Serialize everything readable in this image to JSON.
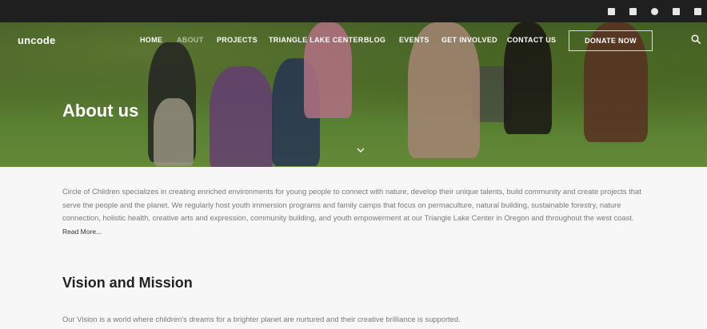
{
  "social": {
    "icons": [
      "facebook-icon",
      "twitter-icon",
      "instagram-icon",
      "email-icon",
      "vimeo-icon"
    ]
  },
  "header": {
    "logo": "uncode",
    "nav": [
      {
        "label": "HOME"
      },
      {
        "label": "ABOUT",
        "active": true
      },
      {
        "label": "PROJECTS"
      },
      {
        "label": "TRIANGLE LAKE CENTER"
      },
      {
        "label": "BLOG"
      },
      {
        "label": "EVENTS"
      },
      {
        "label": "GET INVOLVED"
      },
      {
        "label": "CONTACT US"
      }
    ],
    "donate_label": "DONATE NOW"
  },
  "hero": {
    "title": "About us"
  },
  "main": {
    "intro": "Circle of Children specializes in creating enriched environments for young people to connect with nature, develop their unique talents, build community and create projects that serve the people and the planet. We regularly host youth immersion programs and family camps that focus on permaculture, natural building, sustainable forestry, nature connection, holistic health, creative arts and expression, community building, and youth empowerment at our Triangle Lake Center in Oregon and throughout the west coast.",
    "read_more": "Read More...",
    "section_title": "Vision and Mission",
    "vision": "Our Vision is a world where children's dreams for a brighter planet are nurtured and their creative brilliance is supported."
  },
  "colors": {
    "topbar": "#1f1f1f",
    "background": "#f7f7f7",
    "text_muted": "#7a7a7a"
  }
}
